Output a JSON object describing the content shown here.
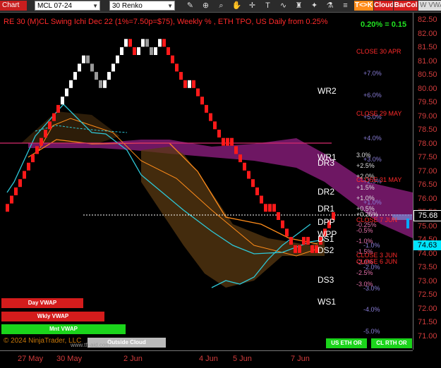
{
  "toolbar": {
    "chart_label": "Chart",
    "symbol": "MCL 07-24",
    "period": "30 Renko",
    "tk_label": "T<>K",
    "cloud_label": "Cloud",
    "barcol_label": "BarCol",
    "vwap_label": "W VWA",
    "tools": [
      "draw-icon",
      "zoom-in-icon",
      "zoom-out-icon",
      "hand-icon",
      "magnifier-icon",
      "text-icon",
      "indicator-icon",
      "strategy-icon",
      "sparkle-icon",
      "flask-icon",
      "list-icon"
    ]
  },
  "chart": {
    "title": "RE 30 (M)CL Swing Ichi Dec 22  (1%=7.50p=$75), Weekly % , ETH TPO, US Daily from 0.25%",
    "pct_change": "0.20% = 0.15",
    "y_ticks": [
      "82.50",
      "82.00",
      "81.50",
      "81.00",
      "80.50",
      "80.00",
      "79.50",
      "79.00",
      "78.50",
      "78.00",
      "77.50",
      "77.00",
      "76.50",
      "76.00",
      "75.50",
      "75.00",
      "74.50",
      "74.00",
      "73.50",
      "73.00",
      "72.50",
      "72.00",
      "71.50",
      "71.00"
    ],
    "x_ticks": [
      "27 May",
      "30 May",
      "2 Jun",
      "4 Jun",
      "5 Jun",
      "7 Jun"
    ],
    "current_price": "75.68",
    "other_price": "74.63",
    "colors": {
      "up": "#ffffff",
      "down": "#ff1a1a",
      "grey": "#999999",
      "cloud_bull": "#7a1a6e",
      "cloud_bear": "#5a3a12",
      "cyan": "#2ec8d8",
      "orange": "#ff8c1a"
    }
  },
  "levels": [
    {
      "name": "WR2",
      "color": "#8a7ed8"
    },
    {
      "name": "WR1",
      "color": "#8a7ed8"
    },
    {
      "name": "DR3",
      "color": "#dddddd"
    },
    {
      "name": "DR2",
      "color": "#dddddd"
    },
    {
      "name": "DR1",
      "color": "#dddddd"
    },
    {
      "name": "DPP",
      "color": "#ffffff"
    },
    {
      "name": "WPP",
      "color": "#ffffff"
    },
    {
      "name": "DS1",
      "color": "#e46fa8"
    },
    {
      "name": "DS2",
      "color": "#e46fa8"
    },
    {
      "name": "DS3",
      "color": "#e46fa8"
    },
    {
      "name": "WS1",
      "color": "#8a7ed8"
    }
  ],
  "weekly_pct": [
    "+7.0%",
    "+6.0%",
    "+5.0%",
    "+4.0%",
    "+3.0%",
    "+2.0%",
    "+1.0%",
    "-1.0%",
    "-2.0%",
    "-3.0%",
    "-4.0%",
    "-5.0%"
  ],
  "daily_pct": [
    "3.0%",
    "+2.5%",
    "+2.0%",
    "+1.5%",
    "+1.0%",
    "+0.5%",
    "+0.25%",
    "-0.25%",
    "-0.5%",
    "-1.0%",
    "-1.5%",
    "-2.0%",
    "-2.5%",
    "-3.0%"
  ],
  "closes": [
    "CLOSE 30 APR",
    "CLOSE 29 MAY",
    "CLOSE 31 MAY",
    "CLOSE 7 JUN",
    "CLOSE 3 JUN",
    "CLOSE 6 JUN"
  ],
  "buttons": {
    "day_vwap": "Day VWAP",
    "wkly_vwap": "Wkly VWAP",
    "mnt_vwap": "Mnt VWAP",
    "outside_cloud": "Outside Cloud",
    "us_eth_or": "US ETH OR",
    "cl_rth_or": "CL RTH OR"
  },
  "copyright": "© 2024 NinjaTrader, LLC",
  "copyright_small": "www.tfi-aid.com"
}
